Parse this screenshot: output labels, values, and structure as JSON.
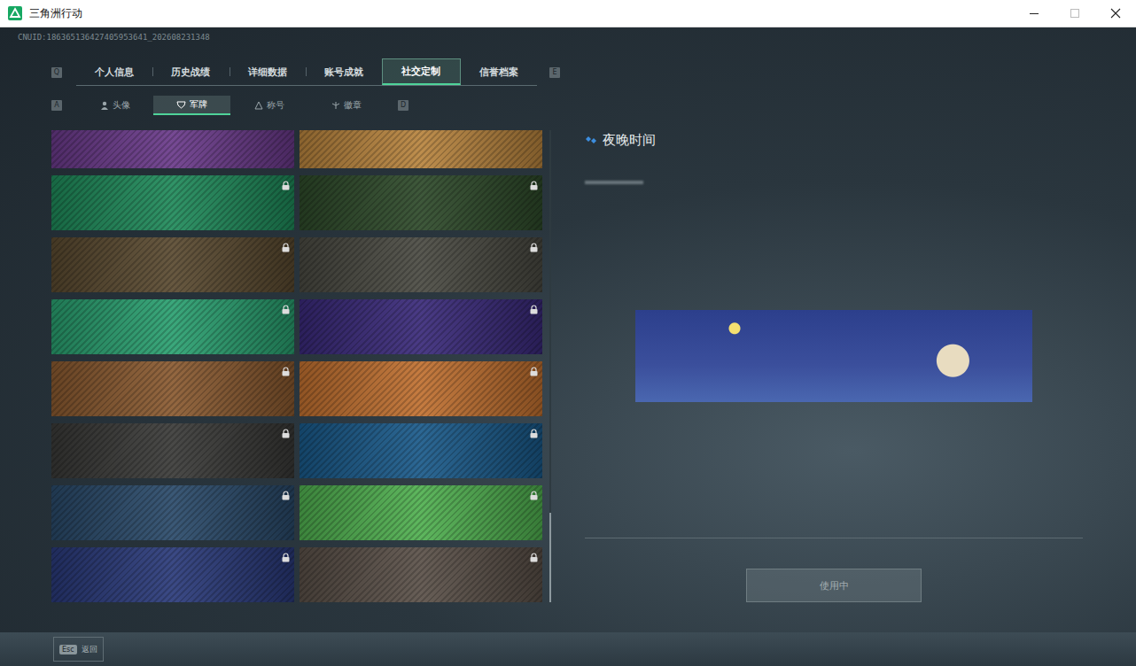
{
  "window": {
    "title": "三角洲行动"
  },
  "uid": "CNUID:186365136427405953641_202608231348",
  "tabs": {
    "prev_key": "Q",
    "next_key": "E",
    "items": [
      {
        "label": "个人信息",
        "selected": false
      },
      {
        "label": "历史战绩",
        "selected": false
      },
      {
        "label": "详细数据",
        "selected": false
      },
      {
        "label": "账号成就",
        "selected": false
      },
      {
        "label": "社交定制",
        "selected": true
      },
      {
        "label": "信誉档案",
        "selected": false
      }
    ]
  },
  "subtabs": {
    "prev_key": "A",
    "next_key": "D",
    "items": [
      {
        "label": "头像",
        "selected": false
      },
      {
        "label": "军牌",
        "selected": true
      },
      {
        "label": "称号",
        "selected": false
      },
      {
        "label": "徽章",
        "selected": false
      }
    ]
  },
  "cards": [
    {
      "locked": false,
      "selected": false,
      "color": "#6a3a8a"
    },
    {
      "locked": false,
      "selected": false,
      "color": "#b8843e"
    },
    {
      "locked": true,
      "selected": false,
      "color": "#1f8a5a"
    },
    {
      "locked": true,
      "selected": false,
      "color": "#2e4a2a"
    },
    {
      "locked": true,
      "selected": false,
      "color": "#5a4a30"
    },
    {
      "locked": true,
      "selected": false,
      "color": "#4a4a42"
    },
    {
      "locked": true,
      "selected": false,
      "color": "#2aa070"
    },
    {
      "locked": true,
      "selected": false,
      "color": "#3a2a7a"
    },
    {
      "locked": true,
      "selected": false,
      "color": "#8a5a30"
    },
    {
      "locked": true,
      "selected": false,
      "color": "#c07030"
    },
    {
      "locked": true,
      "selected": false,
      "color": "#3a3a38"
    },
    {
      "locked": true,
      "selected": false,
      "color": "#1a5a8a"
    },
    {
      "locked": true,
      "selected": false,
      "color": "#2a4a6a"
    },
    {
      "locked": true,
      "selected": false,
      "color": "#50b050"
    },
    {
      "locked": true,
      "selected": false,
      "color": "#2a3a7a"
    },
    {
      "locked": true,
      "selected": false,
      "color": "#5a5048"
    }
  ],
  "scrollbar": {
    "level": 1
  },
  "detail": {
    "title": "夜晚时间",
    "button": {
      "label": "使用中",
      "disabled": true
    }
  },
  "footer": {
    "key": "Esc",
    "label": "返回"
  }
}
